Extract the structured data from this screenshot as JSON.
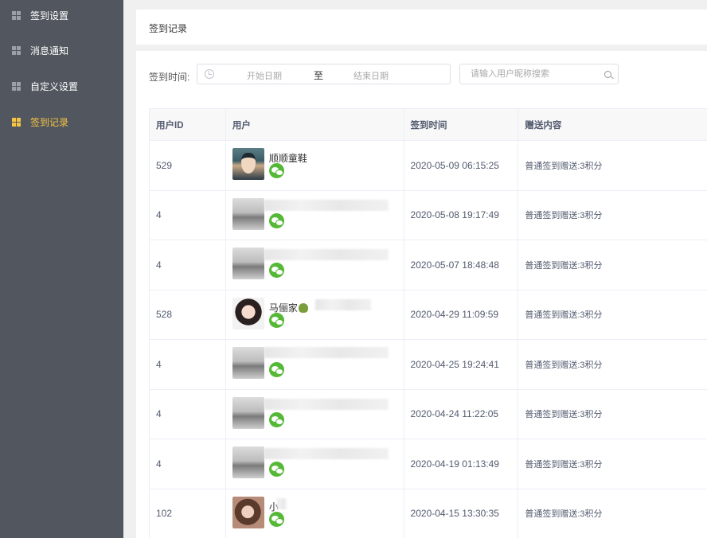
{
  "sidebar": {
    "items": [
      {
        "label": "签到设置",
        "active": false
      },
      {
        "label": "消息通知",
        "active": false
      },
      {
        "label": "自定义设置",
        "active": false
      },
      {
        "label": "签到记录",
        "active": true
      }
    ]
  },
  "header": {
    "title": "签到记录"
  },
  "filter": {
    "label": "签到时间:",
    "start_placeholder": "开始日期",
    "range_separator": "至",
    "end_placeholder": "结束日期",
    "search_placeholder": "请输入用户昵称搜索"
  },
  "table": {
    "columns": [
      "用户ID",
      "用户",
      "签到时间",
      "赠送内容"
    ],
    "rows": [
      {
        "id": "529",
        "name": "顺顺童鞋",
        "avatar": "anime",
        "time": "2020-05-09 06:15:25",
        "reward": "普通签到赠送:3积分"
      },
      {
        "id": "4",
        "name": "",
        "avatar": "room",
        "time": "2020-05-08 19:17:49",
        "reward": "普通签到赠送:3积分"
      },
      {
        "id": "4",
        "name": "",
        "avatar": "room",
        "time": "2020-05-07 18:48:48",
        "reward": "普通签到赠送:3积分"
      },
      {
        "id": "528",
        "name": "马俪家",
        "avatar": "girl1",
        "time": "2020-04-29 11:09:59",
        "reward": "普通签到赠送:3积分"
      },
      {
        "id": "4",
        "name": "",
        "avatar": "room",
        "time": "2020-04-25 19:24:41",
        "reward": "普通签到赠送:3积分"
      },
      {
        "id": "4",
        "name": "",
        "avatar": "room",
        "time": "2020-04-24 11:22:05",
        "reward": "普通签到赠送:3积分"
      },
      {
        "id": "4",
        "name": "",
        "avatar": "room",
        "time": "2020-04-19 01:13:49",
        "reward": "普通签到赠送:3积分"
      },
      {
        "id": "102",
        "name": "小",
        "avatar": "girl2",
        "time": "2020-04-15 13:30:35",
        "reward": "普通签到赠送:3积分"
      }
    ]
  }
}
